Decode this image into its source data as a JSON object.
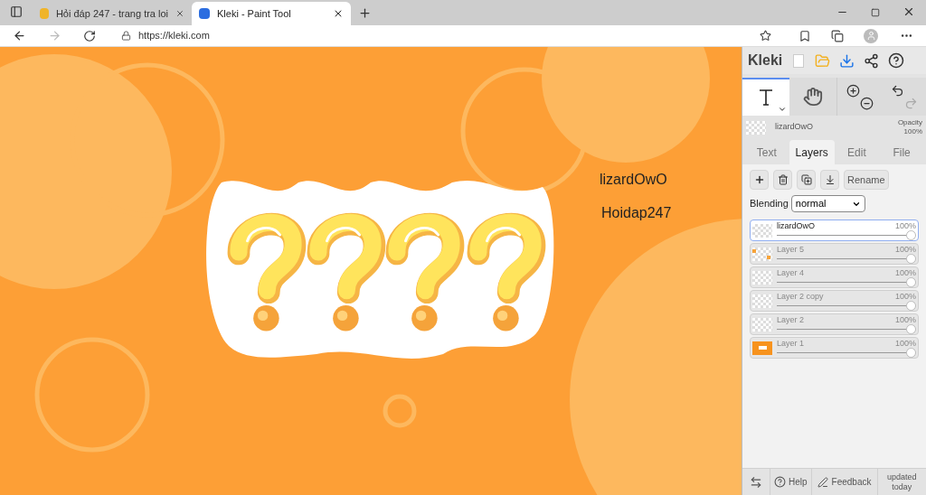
{
  "browser": {
    "tabs": [
      {
        "title": "Hỏi đáp 247 - trang tra loi",
        "selected": false
      },
      {
        "title": "Kleki - Paint Tool",
        "selected": true
      }
    ],
    "url": "https://kleki.com"
  },
  "canvas": {
    "texts": [
      "lizardOwO",
      "Hoidap247"
    ]
  },
  "sidebar": {
    "brand": "Kleki",
    "tools": [
      {
        "kind": "text",
        "selected": true
      },
      {
        "kind": "hand",
        "selected": false
      }
    ],
    "current_layer": {
      "name": "lizardOwO",
      "opacity_label": "Opacity",
      "opacity": "100%"
    },
    "tabs": [
      {
        "label": "Text",
        "selected": false
      },
      {
        "label": "Layers",
        "selected": true
      },
      {
        "label": "Edit",
        "selected": false
      },
      {
        "label": "File",
        "selected": false
      }
    ],
    "rename": "Rename",
    "blending": {
      "label": "Blending",
      "value": "normal"
    },
    "layers": [
      {
        "name": "lizardOwO",
        "opacity": "100%",
        "level": 1,
        "selected": true,
        "kind": "checker"
      },
      {
        "name": "Layer 5",
        "opacity": "100%",
        "level": 1,
        "selected": false,
        "kind": "dots"
      },
      {
        "name": "Layer 4",
        "opacity": "100%",
        "level": 1,
        "selected": false,
        "kind": "checker"
      },
      {
        "name": "Layer 2 copy",
        "opacity": "100%",
        "level": 1,
        "selected": false,
        "kind": "checker"
      },
      {
        "name": "Layer 2",
        "opacity": "100%",
        "level": 1,
        "selected": false,
        "kind": "checker"
      },
      {
        "name": "Layer 1",
        "opacity": "100%",
        "level": 1,
        "selected": false,
        "kind": "solid"
      }
    ],
    "footer": {
      "help": "Help",
      "feedback": "Feedback",
      "updated": "updated today"
    }
  }
}
